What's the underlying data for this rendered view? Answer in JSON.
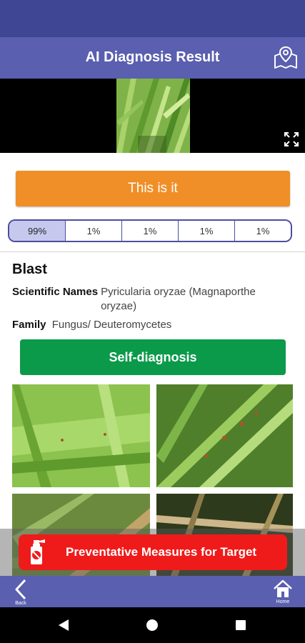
{
  "header": {
    "title": "AI Diagnosis Result",
    "map_icon": "map-location-icon"
  },
  "photo": {
    "expand_icon": "expand-icon"
  },
  "actions": {
    "confirm_label": "This is it",
    "self_diagnosis_label": "Self-diagnosis",
    "prevent_label": "Preventative Measures for Target"
  },
  "colors": {
    "header_bg": "#5a5fb0",
    "status_bg": "#3f4795",
    "confirm_btn": "#f08f27",
    "self_btn": "#0b9a4a",
    "prevent_btn": "#ef1b1b",
    "tab_selected": "#c6c8ee"
  },
  "candidates": [
    {
      "percent": "99%"
    },
    {
      "percent": "1%"
    },
    {
      "percent": "1%"
    },
    {
      "percent": "1%"
    },
    {
      "percent": "1%"
    }
  ],
  "disease": {
    "name": "Blast",
    "scientific_label": "Scientific Names",
    "scientific_value": "Pyricularia oryzae (Magnaporthe oryzae)",
    "family_label": "Family",
    "family_value": "Fungus/ Deuteromycetes"
  },
  "bottom_nav": {
    "back_label": "Back",
    "home_label": "Home"
  }
}
